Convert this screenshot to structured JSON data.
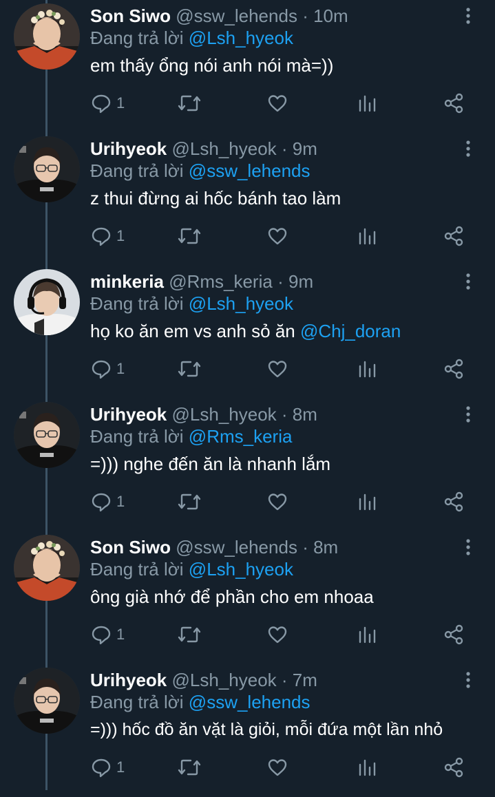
{
  "reply_prefix": "Đang trả lời",
  "dot": "·",
  "colors": {
    "background": "#15202b",
    "text": "#ffffff",
    "muted": "#8899a6",
    "link": "#1da1f2",
    "thread_line": "#3d5466"
  },
  "tweets": [
    {
      "name": "Son Siwo",
      "handle": "@ssw_lehends",
      "time": "10m",
      "reply_to": "@Lsh_hyeok",
      "text": "em thấy ổng nói anh nói mà=))",
      "text_mention": "",
      "reply_count": "1",
      "avatar": "flower-crown-avatar"
    },
    {
      "name": "Urihyeok",
      "handle": "@Lsh_hyeok",
      "time": "9m",
      "reply_to": "@ssw_lehends",
      "text": "z thui đừng ai hốc bánh tao làm",
      "text_mention": "",
      "reply_count": "1",
      "avatar": "glasses-player-avatar"
    },
    {
      "name": "minkeria",
      "handle": "@Rms_keria",
      "time": "9m",
      "reply_to": "@Lsh_hyeok",
      "text": "họ ko ăn em vs anh sỏ ăn ",
      "text_mention": "@Chj_doran",
      "reply_count": "1",
      "avatar": "headset-player-avatar"
    },
    {
      "name": "Urihyeok",
      "handle": "@Lsh_hyeok",
      "time": "8m",
      "reply_to": "@Rms_keria",
      "text": "=))) nghe đến ăn là nhanh lắm",
      "text_mention": "",
      "reply_count": "1",
      "avatar": "glasses-player-avatar"
    },
    {
      "name": "Son Siwo",
      "handle": "@ssw_lehends",
      "time": "8m",
      "reply_to": "@Lsh_hyeok",
      "text": "ông già nhớ để phần cho em nhoaa",
      "text_mention": "",
      "reply_count": "1",
      "avatar": "flower-crown-avatar"
    },
    {
      "name": "Urihyeok",
      "handle": "@Lsh_hyeok",
      "time": "7m",
      "reply_to": "@ssw_lehends",
      "text": "=))) hốc đồ ăn vặt là giỏi, mỗi đứa một lần nhỏ",
      "text_mention": "",
      "reply_count": "1",
      "avatar": "glasses-player-avatar"
    }
  ]
}
